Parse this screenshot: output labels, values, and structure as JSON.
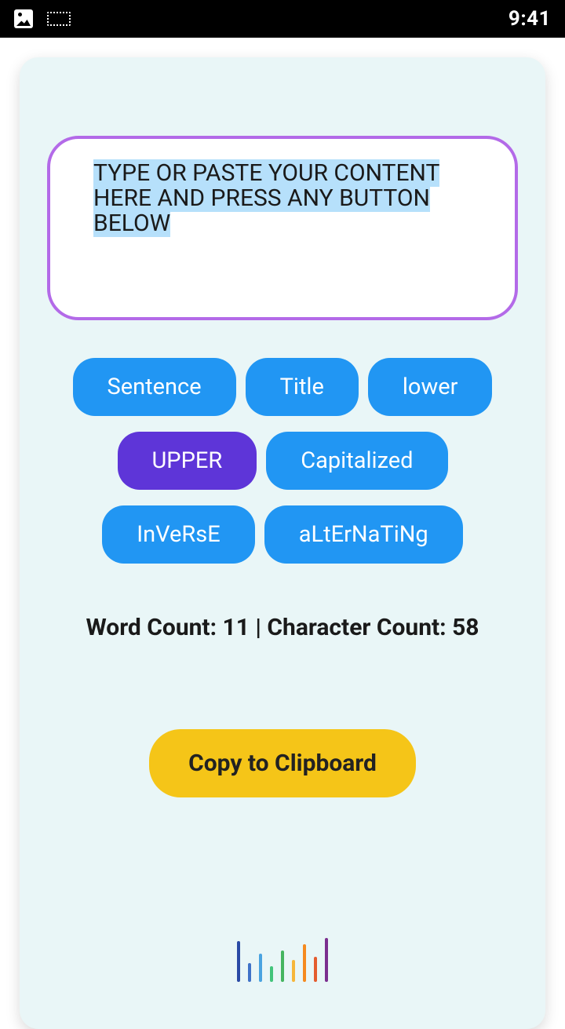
{
  "status": {
    "time": "9:41"
  },
  "input": {
    "text": "TYPE OR PASTE YOUR CONTENT HERE AND PRESS ANY BUTTON BELOW"
  },
  "buttons": {
    "sentence": "Sentence",
    "title": "Title",
    "lower": "lower",
    "upper": "UPPER",
    "capitalized": "Capitalized",
    "inverse": "InVeRsE",
    "alternating": "aLtErNaTiNg"
  },
  "counts": {
    "label": "Word Count: 11 | Character Count: 58",
    "word_count": 11,
    "character_count": 58
  },
  "copy": {
    "label": "Copy to Clipboard"
  }
}
